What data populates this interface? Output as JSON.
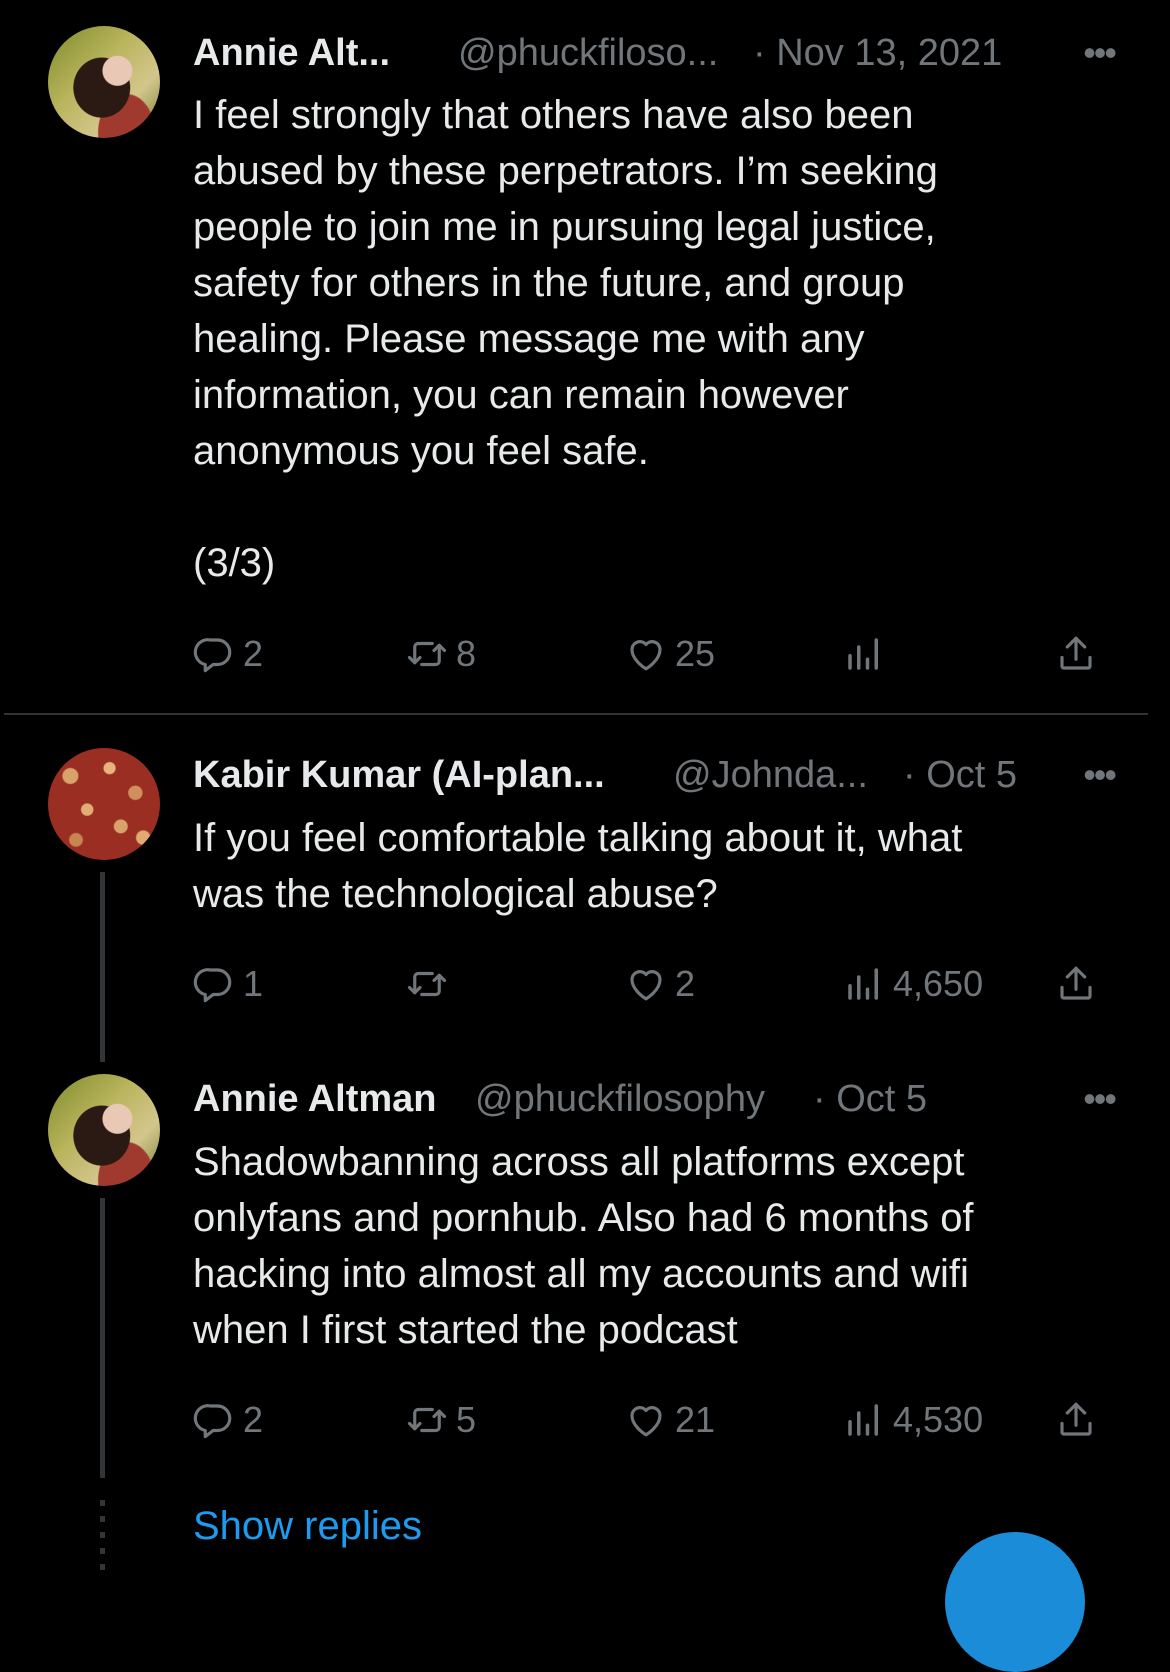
{
  "tweets": [
    {
      "author": "Annie Alt...",
      "handle": "@phuckfiloso...",
      "date": "· Nov 13, 2021",
      "text": "I feel strongly that others have also been\nabused by these perpetrators. I’m seeking\npeople to join me in pursuing legal justice,\nsafety for others in the future, and group\nhealing. Please message me with any\ninformation, you can remain however\nanonymous you feel safe.\n\n(3/3)",
      "replies": "2",
      "retweets": "8",
      "likes": "25",
      "views": ""
    },
    {
      "author": "Kabir Kumar (AI-plan...",
      "handle": "@Johnda...",
      "date": "· Oct 5",
      "text": "If you feel comfortable talking about it, what\nwas the technological abuse?",
      "replies": "1",
      "retweets": "",
      "likes": "2",
      "views": "4,650"
    },
    {
      "author": "Annie Altman",
      "handle": "@phuckfilosophy",
      "date": "· Oct 5",
      "text": "Shadowbanning across all platforms except\nonlyfans and pornhub. Also had 6 months of\nhacking into almost all my accounts and wifi\nwhen I first started the podcast",
      "replies": "2",
      "retweets": "5",
      "likes": "21",
      "views": "4,530"
    }
  ],
  "show_replies": "Show replies",
  "more_label": "•••",
  "colors": {
    "background": "#000000",
    "text": "#e7e9ea",
    "muted": "#71767b",
    "link": "#1d9bf0"
  },
  "icons": [
    "reply-icon",
    "retweet-icon",
    "like-icon",
    "views-icon",
    "share-icon",
    "more-icon"
  ]
}
